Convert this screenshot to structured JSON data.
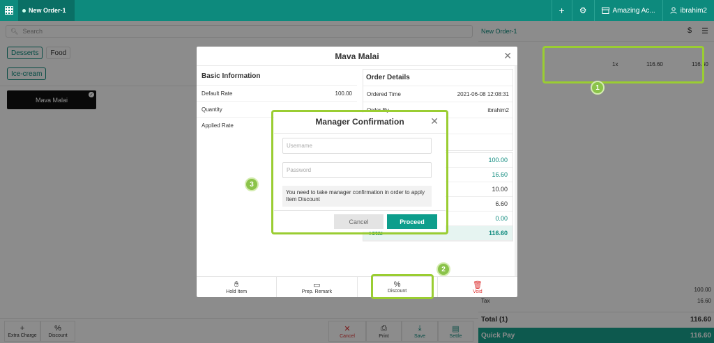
{
  "topbar": {
    "order_tab": "New Order-1",
    "outlet": "Amazing Ac...",
    "user": "ibrahim2"
  },
  "search": {
    "placeholder": "Search"
  },
  "categories": [
    {
      "label": "Desserts",
      "active": true
    },
    {
      "label": "Food",
      "active": false
    }
  ],
  "subcategory": "Ice-cream",
  "item_card": "Mava Malai",
  "bottom_actions": {
    "extra_charge": "Extra Charge",
    "discount": "Discount",
    "cancel": "Cancel",
    "print": "Print",
    "save": "Save",
    "settle": "Settle"
  },
  "cart": {
    "title": "New Order-1",
    "line_qty": "1x",
    "line_price": "116.60",
    "line_total": "116.60",
    "subtotal": "100.00",
    "tax_label": "Tax",
    "tax": "16.60",
    "total_label": "Total",
    "total_count": "(1)",
    "total": "116.60",
    "quick_pay": "Quick Pay",
    "quick_pay_amount": "116.60"
  },
  "item_modal": {
    "title": "Mava Malai",
    "basic_info": "Basic Information",
    "default_rate_label": "Default Rate",
    "default_rate": "100.00",
    "quantity_label": "Quantity",
    "applied_rate_label": "Applied Rate",
    "order_details": "Order Details",
    "ordered_time_label": "Ordered Time",
    "ordered_time": "2021-06-08 12:08:31",
    "order_by_label": "Order By",
    "order_by": "ibrahim2",
    "summary": [
      "100.00",
      "16.60",
      "10.00",
      "6.60",
      "0.00"
    ],
    "total_label": "Total",
    "total": "116.60",
    "actions": {
      "hold": "Hold Item",
      "remark": "Prep. Remark",
      "discount": "Discount",
      "void": "Void"
    }
  },
  "manager": {
    "title": "Manager Confirmation",
    "username_placeholder": "Username",
    "password_placeholder": "Password",
    "note": "You need to take manager confirmation in order to apply Item Discount",
    "cancel": "Cancel",
    "proceed": "Proceed"
  },
  "badges": [
    "1",
    "2",
    "3"
  ]
}
